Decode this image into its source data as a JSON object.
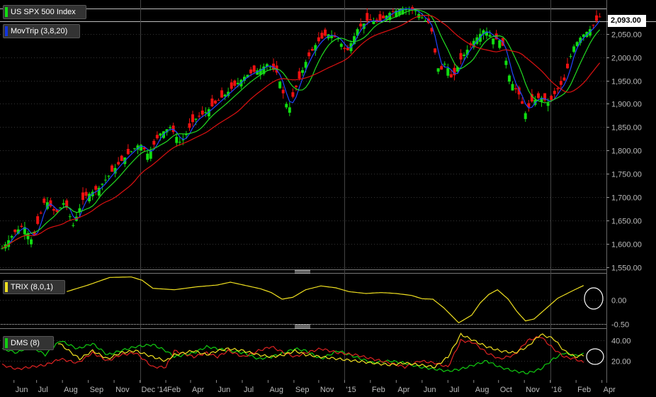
{
  "chart_data": [
    {
      "type": "candlestick",
      "title": "US SPX 500 Index",
      "overlay": {
        "label": "MovTrip (3,8,20)",
        "lines": [
          "fast",
          "medium",
          "slow"
        ]
      },
      "last_price_label": "2,093.00",
      "y_ticks": [
        "2,050.00",
        "2,000.00",
        "1,950.00",
        "1,900.00",
        "1,850.00",
        "1,800.00",
        "1,750.00",
        "1,700.00",
        "1,650.00",
        "1,600.00",
        "1,550.00"
      ],
      "y_tick_values": [
        2050,
        2000,
        1950,
        1900,
        1850,
        1800,
        1750,
        1700,
        1650,
        1600,
        1550
      ],
      "ylim": [
        1545,
        2115
      ],
      "x_labels": [
        "Jun",
        "Jul",
        "Aug",
        "Sep",
        "Nov",
        "Dec '14",
        "Feb",
        "Apr",
        "Jun",
        "Jul",
        "Aug",
        "Sep",
        "Nov",
        "'15",
        "Feb",
        "Apr",
        "Jun",
        "Jul",
        "Aug",
        "Oct",
        "Nov",
        "'16",
        "Feb",
        "Apr"
      ],
      "x_label_positions": [
        11,
        32,
        56,
        80,
        104,
        128,
        152,
        175,
        199,
        223,
        247,
        271,
        294,
        318,
        342,
        366,
        390,
        414,
        438,
        461,
        485,
        509,
        533,
        557
      ],
      "year_dividers": [
        "'14",
        "'15",
        "'16"
      ],
      "close_anchors": [
        [
          0,
          1590
        ],
        [
          12,
          1625
        ],
        [
          20,
          1640
        ],
        [
          28,
          1605
        ],
        [
          34,
          1650
        ],
        [
          40,
          1695
        ],
        [
          50,
          1665
        ],
        [
          58,
          1690
        ],
        [
          66,
          1640
        ],
        [
          76,
          1700
        ],
        [
          90,
          1720
        ],
        [
          104,
          1760
        ],
        [
          116,
          1790
        ],
        [
          128,
          1815
        ],
        [
          136,
          1790
        ],
        [
          146,
          1835
        ],
        [
          156,
          1850
        ],
        [
          166,
          1815
        ],
        [
          178,
          1865
        ],
        [
          188,
          1880
        ],
        [
          200,
          1905
        ],
        [
          212,
          1930
        ],
        [
          226,
          1960
        ],
        [
          240,
          1975
        ],
        [
          246,
          1985
        ],
        [
          256,
          1965
        ],
        [
          260,
          1930
        ],
        [
          266,
          1885
        ],
        [
          272,
          1930
        ],
        [
          282,
          1990
        ],
        [
          292,
          2030
        ],
        [
          302,
          2050
        ],
        [
          312,
          2040
        ],
        [
          320,
          2010
        ],
        [
          330,
          2060
        ],
        [
          340,
          2080
        ],
        [
          350,
          2075
        ],
        [
          360,
          2095
        ],
        [
          372,
          2105
        ],
        [
          384,
          2100
        ],
        [
          392,
          2080
        ],
        [
          398,
          2070
        ],
        [
          402,
          2010
        ],
        [
          406,
          1965
        ],
        [
          412,
          1990
        ],
        [
          418,
          1950
        ],
        [
          426,
          1995
        ],
        [
          436,
          2030
        ],
        [
          448,
          2060
        ],
        [
          456,
          2040
        ],
        [
          464,
          2035
        ],
        [
          472,
          1950
        ],
        [
          480,
          1920
        ],
        [
          486,
          1880
        ],
        [
          492,
          1905
        ],
        [
          500,
          1915
        ],
        [
          508,
          1900
        ],
        [
          514,
          1925
        ],
        [
          522,
          1950
        ],
        [
          530,
          2020
        ],
        [
          538,
          2045
        ],
        [
          546,
          2060
        ],
        [
          557,
          2093
        ]
      ]
    },
    {
      "type": "line",
      "title": "TRIX (8,0,1)",
      "y_ticks": [
        "0.00",
        "-0.50"
      ],
      "y_tick_values": [
        0,
        -0.5
      ],
      "ylim": [
        -0.58,
        0.5
      ],
      "anchors": [
        [
          60,
          0.18
        ],
        [
          80,
          0.32
        ],
        [
          100,
          0.48
        ],
        [
          120,
          0.49
        ],
        [
          130,
          0.42
        ],
        [
          140,
          0.25
        ],
        [
          160,
          0.22
        ],
        [
          180,
          0.28
        ],
        [
          200,
          0.32
        ],
        [
          212,
          0.38
        ],
        [
          224,
          0.32
        ],
        [
          240,
          0.24
        ],
        [
          250,
          0.16
        ],
        [
          260,
          0.02
        ],
        [
          270,
          0.06
        ],
        [
          282,
          0.22
        ],
        [
          296,
          0.3
        ],
        [
          310,
          0.26
        ],
        [
          322,
          0.18
        ],
        [
          338,
          0.14
        ],
        [
          352,
          0.16
        ],
        [
          366,
          0.14
        ],
        [
          380,
          0.1
        ],
        [
          390,
          0.03
        ],
        [
          400,
          0.02
        ],
        [
          410,
          -0.16
        ],
        [
          424,
          -0.48
        ],
        [
          436,
          -0.32
        ],
        [
          444,
          -0.06
        ],
        [
          452,
          0.12
        ],
        [
          460,
          0.22
        ],
        [
          470,
          0.02
        ],
        [
          478,
          -0.24
        ],
        [
          486,
          -0.44
        ],
        [
          494,
          -0.4
        ],
        [
          504,
          -0.2
        ],
        [
          516,
          0.04
        ],
        [
          530,
          0.2
        ],
        [
          541,
          0.32
        ]
      ]
    },
    {
      "type": "line",
      "title": "DMS (8)",
      "y_ticks": [
        "40.00",
        "20.00"
      ],
      "y_tick_values": [
        40,
        20
      ],
      "ylim": [
        2,
        50
      ],
      "series": [
        {
          "color": "#11cc11",
          "anchors": [
            [
              0,
              32
            ],
            [
              14,
              28
            ],
            [
              26,
              35
            ],
            [
              40,
              26
            ],
            [
              54,
              40
            ],
            [
              70,
              32
            ],
            [
              84,
              37
            ],
            [
              98,
              26
            ],
            [
              110,
              30
            ],
            [
              124,
              34
            ],
            [
              140,
              36
            ],
            [
              152,
              30
            ],
            [
              160,
              24
            ],
            [
              178,
              28
            ],
            [
              190,
              34
            ],
            [
              200,
              32
            ],
            [
              210,
              30
            ],
            [
              224,
              28
            ],
            [
              238,
              22
            ],
            [
              250,
              24
            ],
            [
              262,
              28
            ],
            [
              272,
              32
            ],
            [
              282,
              30
            ],
            [
              296,
              22
            ],
            [
              312,
              30
            ],
            [
              328,
              24
            ],
            [
              344,
              18
            ],
            [
              360,
              20
            ],
            [
              374,
              18
            ],
            [
              388,
              14
            ],
            [
              402,
              12
            ],
            [
              414,
              10
            ],
            [
              426,
              12
            ],
            [
              438,
              16
            ],
            [
              450,
              20
            ],
            [
              462,
              14
            ],
            [
              476,
              10
            ],
            [
              488,
              8
            ],
            [
              500,
              12
            ],
            [
              512,
              22
            ],
            [
              522,
              28
            ],
            [
              532,
              25
            ],
            [
              541,
              27
            ]
          ]
        },
        {
          "color": "#dd2222",
          "anchors": [
            [
              0,
              16
            ],
            [
              14,
              12
            ],
            [
              26,
              14
            ],
            [
              40,
              16
            ],
            [
              54,
              22
            ],
            [
              70,
              18
            ],
            [
              84,
              28
            ],
            [
              98,
              20
            ],
            [
              110,
              26
            ],
            [
              124,
              28
            ],
            [
              140,
              14
            ],
            [
              152,
              14
            ],
            [
              160,
              30
            ],
            [
              178,
              24
            ],
            [
              190,
              28
            ],
            [
              200,
              24
            ],
            [
              210,
              30
            ],
            [
              224,
              24
            ],
            [
              238,
              30
            ],
            [
              250,
              34
            ],
            [
              262,
              28
            ],
            [
              272,
              24
            ],
            [
              282,
              28
            ],
            [
              296,
              32
            ],
            [
              312,
              28
            ],
            [
              328,
              26
            ],
            [
              344,
              22
            ],
            [
              360,
              18
            ],
            [
              374,
              14
            ],
            [
              388,
              20
            ],
            [
              402,
              18
            ],
            [
              414,
              14
            ],
            [
              426,
              40
            ],
            [
              438,
              38
            ],
            [
              450,
              28
            ],
            [
              462,
              22
            ],
            [
              476,
              26
            ],
            [
              488,
              40
            ],
            [
              500,
              44
            ],
            [
              512,
              32
            ],
            [
              522,
              24
            ],
            [
              532,
              22
            ],
            [
              541,
              18
            ]
          ]
        },
        {
          "color": "#f0e020",
          "anchors": [
            [
              52,
              38
            ],
            [
              62,
              30
            ],
            [
              72,
              22
            ],
            [
              84,
              30
            ],
            [
              98,
              22
            ],
            [
              110,
              28
            ],
            [
              124,
              30
            ],
            [
              140,
              24
            ],
            [
              152,
              20
            ],
            [
              160,
              26
            ],
            [
              178,
              30
            ],
            [
              190,
              26
            ],
            [
              200,
              30
            ],
            [
              210,
              32
            ],
            [
              224,
              30
            ],
            [
              238,
              26
            ],
            [
              250,
              24
            ],
            [
              262,
              26
            ],
            [
              272,
              30
            ],
            [
              282,
              26
            ],
            [
              296,
              24
            ],
            [
              312,
              22
            ],
            [
              328,
              20
            ],
            [
              344,
              18
            ],
            [
              360,
              16
            ],
            [
              374,
              18
            ],
            [
              388,
              16
            ],
            [
              402,
              14
            ],
            [
              414,
              24
            ],
            [
              426,
              46
            ],
            [
              438,
              40
            ],
            [
              450,
              34
            ],
            [
              462,
              30
            ],
            [
              476,
              28
            ],
            [
              488,
              34
            ],
            [
              500,
              46
            ],
            [
              512,
              42
            ],
            [
              522,
              30
            ],
            [
              532,
              24
            ],
            [
              541,
              26
            ]
          ]
        }
      ]
    }
  ]
}
